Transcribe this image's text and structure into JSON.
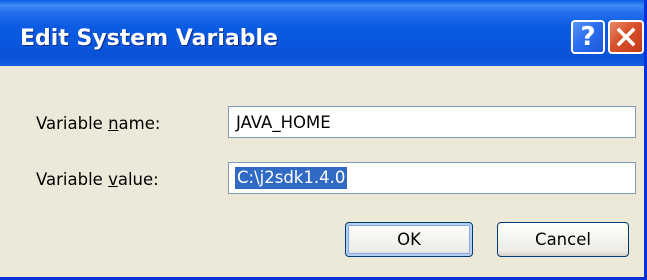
{
  "window": {
    "title": "Edit System Variable",
    "help_label": "?"
  },
  "form": {
    "name_label_pre": "Variable ",
    "name_label_accel": "n",
    "name_label_post": "ame:",
    "name_value": "JAVA_HOME",
    "value_label_pre": "Variable ",
    "value_label_accel": "v",
    "value_label_post": "alue:",
    "value_value": "C:\\j2sdk1.4.0"
  },
  "buttons": {
    "ok_label": "OK",
    "cancel_label": "Cancel"
  },
  "colors": {
    "title_bar": "#0a5ce6",
    "dialog_bg": "#ece9d8",
    "selection": "#316ac5",
    "close_button": "#d8502c",
    "field_border": "#7f9db9"
  }
}
